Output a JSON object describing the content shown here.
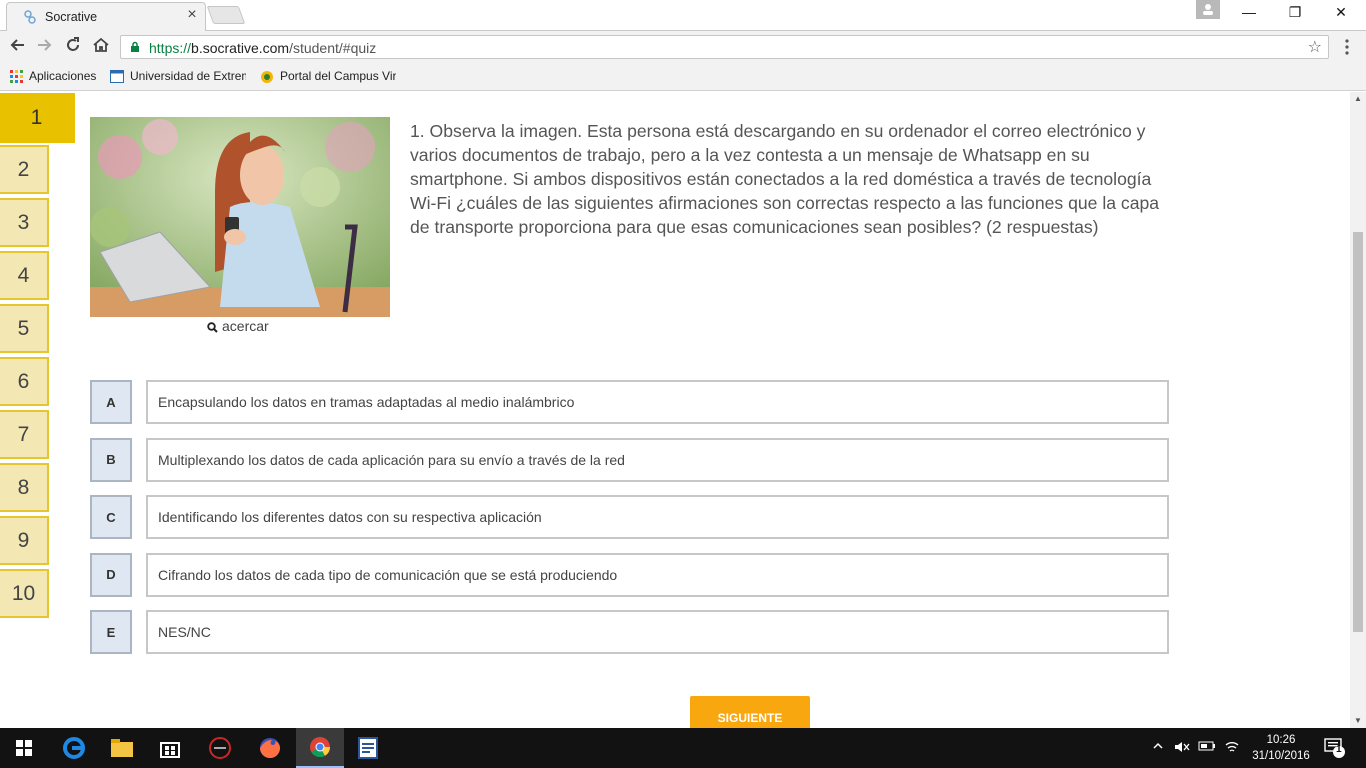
{
  "browser": {
    "tab_title": "Socrative",
    "tab_close": "×",
    "url_scheme": "https://",
    "url_host": "b.socrative.com",
    "url_path": "/student/#quiz",
    "minimize": "—",
    "restore": "❐",
    "close": "✕",
    "star": "☆"
  },
  "bookmarks": [
    {
      "label": "Aplicaciones",
      "icon": "apps-grid-icon"
    },
    {
      "label": "Universidad de Extrem",
      "icon": "university-page-icon"
    },
    {
      "label": "Portal del Campus Vir",
      "icon": "campus-portal-icon"
    }
  ],
  "quiz": {
    "question_numbers": [
      "1",
      "2",
      "3",
      "4",
      "5",
      "6",
      "7",
      "8",
      "9",
      "10"
    ],
    "active_question": 1,
    "question_text": "1. Observa la imagen. Esta persona está descargando en su ordenador el correo electrónico y varios documentos de trabajo, pero a la vez contesta a un mensaje de Whatsapp en su smartphone. Si ambos dispositivos están conectados a la red doméstica a través de tecnología Wi-Fi ¿cuáles de las siguientes afirmaciones son correctas respecto a las funciones que la capa de transporte proporciona para que esas comunicaciones sean posibles? (2 respuestas)",
    "zoom_label": "acercar",
    "options": [
      {
        "letter": "A",
        "text": "Encapsulando los datos en tramas adaptadas al medio inalámbrico"
      },
      {
        "letter": "B",
        "text": "Multiplexando los datos de cada aplicación para su envío a través de la red"
      },
      {
        "letter": "C",
        "text": "Identificando los diferentes datos con su respectiva aplicación"
      },
      {
        "letter": "D",
        "text": "Cifrando los datos de cada tipo de comunicación que se está produciendo"
      },
      {
        "letter": "E",
        "text": "NES/NC"
      }
    ],
    "next_label": "SIGUIENTE"
  },
  "taskbar": {
    "time": "10:26",
    "date": "31/10/2016",
    "notifications_count": "1"
  },
  "colors": {
    "accent_yellow": "#e8c200",
    "next_orange": "#f9a70f",
    "option_letter_bg": "#dfe8f2"
  }
}
